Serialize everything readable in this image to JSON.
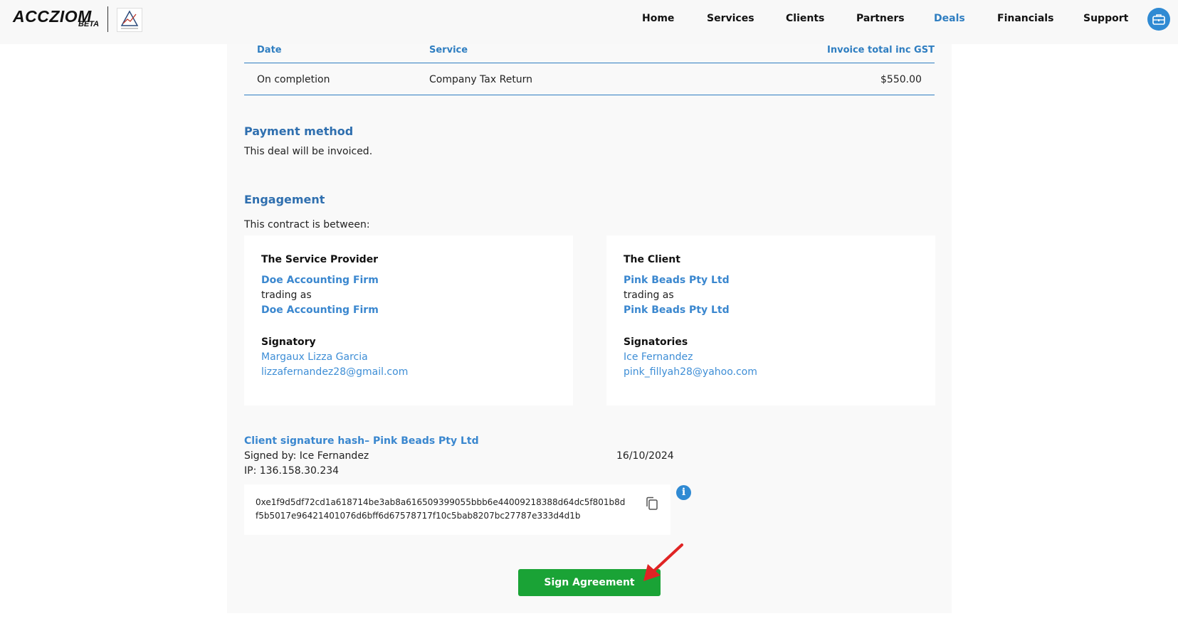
{
  "header": {
    "logo_text": "ACCZIOM",
    "logo_badge": "BETA",
    "nav": [
      {
        "label": "Home",
        "active": false
      },
      {
        "label": "Services",
        "active": false
      },
      {
        "label": "Clients",
        "active": false
      },
      {
        "label": "Partners",
        "active": false
      },
      {
        "label": "Deals",
        "active": true
      },
      {
        "label": "Financials",
        "active": false
      },
      {
        "label": "Support",
        "active": false
      }
    ],
    "accent_color": "#2f7ec1"
  },
  "invoice_table": {
    "columns": [
      "Date",
      "Service",
      "Invoice total inc GST"
    ],
    "rows": [
      {
        "date": "On completion",
        "service": "Company Tax Return",
        "total": "$550.00"
      }
    ]
  },
  "payment": {
    "title": "Payment method",
    "text": "This deal will be invoiced."
  },
  "engagement": {
    "title": "Engagement",
    "intro": "This contract is between:",
    "provider": {
      "label": "The Service Provider",
      "name": "Doe Accounting Firm",
      "trading_as_label": "trading as",
      "trading_name": "Doe Accounting Firm",
      "signatory_label": "Signatory",
      "signatory_name": "Margaux Lizza Garcia",
      "signatory_email": "lizzafernandez28@gmail.com"
    },
    "client": {
      "label": "The Client",
      "name": "Pink Beads Pty Ltd",
      "trading_as_label": "trading as",
      "trading_name": "Pink Beads Pty Ltd",
      "signatory_label": "Signatories",
      "signatory_name": "Ice Fernandez",
      "signatory_email": "pink_fillyah28@yahoo.com"
    }
  },
  "signature": {
    "title": "Client signature hash– Pink Beads Pty Ltd",
    "signed_by": "Signed by: Ice Fernandez",
    "date": "16/10/2024",
    "ip": "IP: 136.158.30.234",
    "hash": "0xe1f9d5df72cd1a618714be3ab8a616509399055bbb6e44009218388d64dc5f801b8df5b5017e96421401076d6bff6d67578717f10c5bab8207bc27787e333d4d1b"
  },
  "actions": {
    "sign_label": "Sign Agreement",
    "sign_color": "#1aa336"
  }
}
